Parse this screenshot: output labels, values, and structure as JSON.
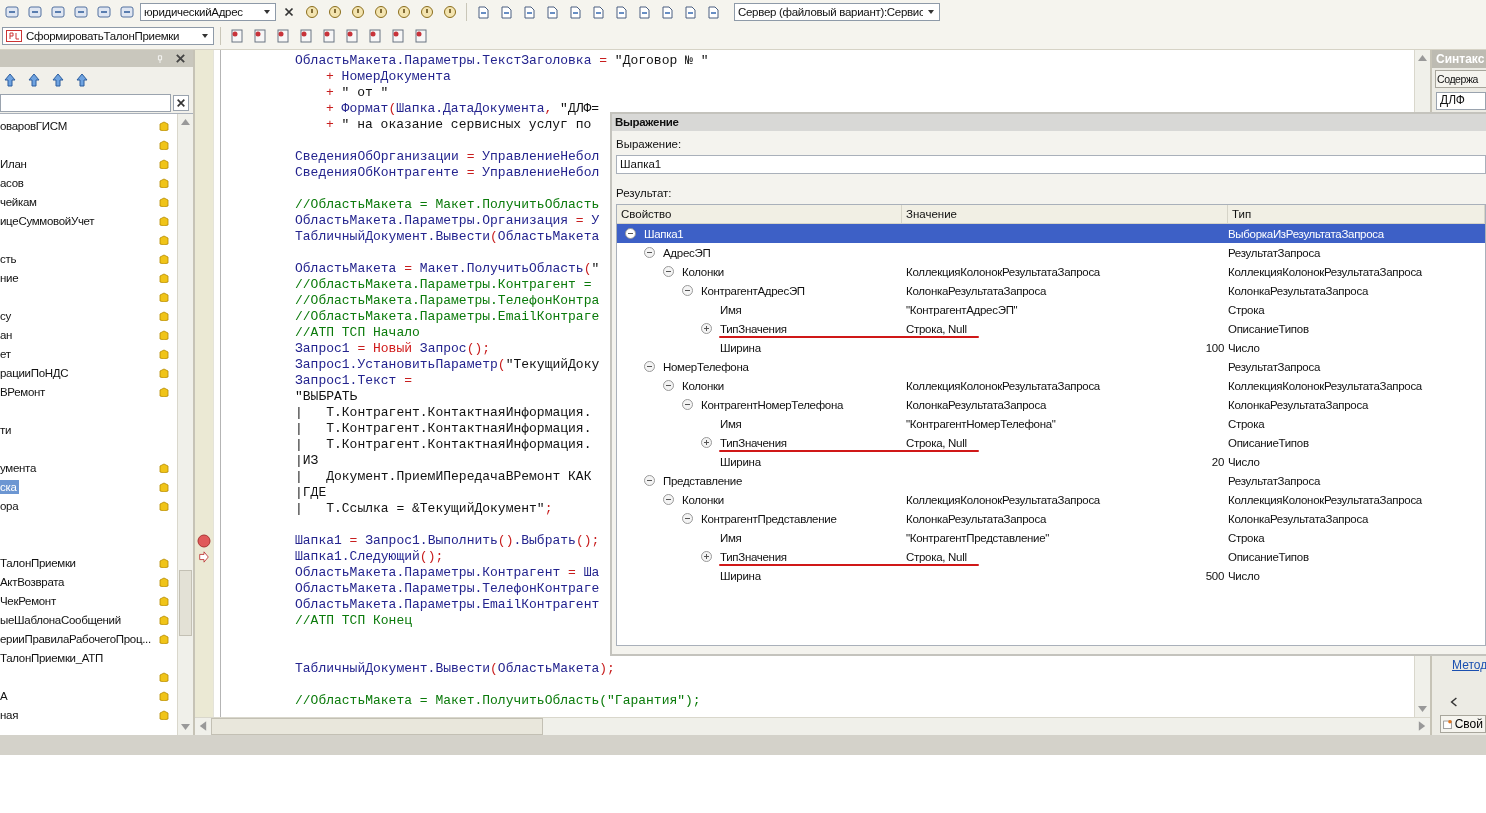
{
  "toolbar": {
    "search": {
      "value": "юридическийАдрес"
    },
    "config": {
      "value": "Сервер (файловый вариант):Сервис"
    },
    "command": {
      "value": "СформироватьТалонПриемки"
    }
  },
  "left_panel": {
    "items": [
      {
        "text": "оваровГИСМ",
        "lock": true,
        "selected": false
      },
      {
        "lock": true,
        "selected": false
      },
      {
        "text": "Илан",
        "lock": true,
        "selected": false
      },
      {
        "text": "асов",
        "lock": true,
        "selected": false
      },
      {
        "text": "чейкам",
        "lock": true,
        "selected": false
      },
      {
        "text": "ицеСуммовойУчет",
        "lock": true,
        "selected": false
      },
      {
        "lock": true,
        "selected": false
      },
      {
        "text": "сть",
        "lock": true,
        "selected": false
      },
      {
        "text": "ние",
        "lock": true,
        "selected": false
      },
      {
        "lock": true,
        "selected": false
      },
      {
        "text": "су",
        "lock": true,
        "selected": false
      },
      {
        "text": "ан",
        "lock": true,
        "selected": false
      },
      {
        "text": "ет",
        "lock": true,
        "selected": false
      },
      {
        "text": "рацииПоНДС",
        "lock": true,
        "selected": false
      },
      {
        "text": "ВРемонт",
        "lock": true,
        "selected": false
      },
      {
        "lock": false,
        "selected": false
      },
      {
        "text": "ти",
        "lock": false,
        "selected": false
      },
      {
        "lock": false,
        "selected": false
      },
      {
        "text": "умента",
        "lock": true,
        "selected": false
      },
      {
        "text": "ска",
        "lock": true,
        "selected": true
      },
      {
        "text": "ора",
        "lock": true,
        "selected": false
      },
      {
        "lock": false,
        "selected": false
      },
      {
        "lock": false,
        "selected": false
      },
      {
        "text": "ТалонПриемки",
        "lock": true,
        "selected": false
      },
      {
        "text": "АктВозврата",
        "lock": true,
        "selected": false
      },
      {
        "text": "ЧекРемонт",
        "lock": true,
        "selected": false
      },
      {
        "text": "ыеШаблонаСообщений",
        "lock": true,
        "selected": false
      },
      {
        "text": "ерииПравилаРабочегоПроц...",
        "lock": true,
        "selected": false
      },
      {
        "text": "ТалонПриемки_АТП",
        "lock": false,
        "selected": false
      },
      {
        "lock": true,
        "selected": false
      },
      {
        "text": "А",
        "lock": true,
        "selected": false
      },
      {
        "text": "ная",
        "lock": true,
        "selected": false
      }
    ]
  },
  "code": {
    "lines": [
      {
        "parts": [
          {
            "text": "ОбластьМакета.Параметры.ТекстЗаголовка",
            "kind": "id"
          },
          {
            "text": " = ",
            "kind": "op"
          },
          {
            "text": "\"Договор № \"",
            "kind": "str"
          }
        ]
      },
      {
        "indent": true,
        "parts": [
          {
            "text": "+ ",
            "kind": "op"
          },
          {
            "text": "НомерДокумента",
            "kind": "id"
          }
        ]
      },
      {
        "indent": true,
        "parts": [
          {
            "text": "+ ",
            "kind": "op"
          },
          {
            "text": "\" от \"",
            "kind": "str"
          }
        ]
      },
      {
        "indent": true,
        "parts": [
          {
            "text": "+ ",
            "kind": "op"
          },
          {
            "text": "Формат",
            "kind": "id"
          },
          {
            "text": "(",
            "kind": "op"
          },
          {
            "text": "Шапка.ДатаДокумента",
            "kind": "id"
          },
          {
            "text": ", ",
            "kind": "op"
          },
          {
            "text": "\"ДЛФ=",
            "kind": "str"
          }
        ]
      },
      {
        "indent": true,
        "parts": [
          {
            "text": "+ ",
            "kind": "op"
          },
          {
            "text": "\" на оказание сервисных услуг по",
            "kind": "str"
          }
        ]
      },
      {
        "gap_before": true,
        "parts": [
          {
            "text": "СведенияОбОрганизации",
            "kind": "id"
          },
          {
            "text": " = ",
            "kind": "op"
          },
          {
            "text": "УправлениеНебол",
            "kind": "id"
          }
        ]
      },
      {
        "parts": [
          {
            "text": "СведенияОбКонтрагенте",
            "kind": "id"
          },
          {
            "text": " = ",
            "kind": "op"
          },
          {
            "text": "УправлениеНебол",
            "kind": "id"
          }
        ]
      },
      {
        "gap_before": true,
        "parts": [
          {
            "text": "//ОбластьМакета = Макет.ПолучитьОбласть",
            "kind": "cmt"
          }
        ]
      },
      {
        "parts": [
          {
            "text": "ОбластьМакета.Параметры.Организация",
            "kind": "id"
          },
          {
            "text": " = ",
            "kind": "op"
          },
          {
            "text": "У",
            "kind": "id"
          }
        ]
      },
      {
        "parts": [
          {
            "text": "ТабличныйДокумент.Вывести",
            "kind": "id"
          },
          {
            "text": "(",
            "kind": "op"
          },
          {
            "text": "ОбластьМакета",
            "kind": "id"
          }
        ]
      },
      {
        "gap_before": true,
        "parts": [
          {
            "text": "ОбластьМакета",
            "kind": "id"
          },
          {
            "text": " = ",
            "kind": "op"
          },
          {
            "text": "Макет.ПолучитьОбласть",
            "kind": "id"
          },
          {
            "text": "(",
            "kind": "op"
          },
          {
            "text": "\"",
            "kind": "str"
          }
        ]
      },
      {
        "parts": [
          {
            "text": "//ОбластьМакета.Параметры.Контрагент =",
            "kind": "cmt"
          }
        ]
      },
      {
        "parts": [
          {
            "text": "//ОбластьМакета.Параметры.ТелефонКонтра",
            "kind": "cmt"
          }
        ]
      },
      {
        "parts": [
          {
            "text": "//ОбластьМакета.Параметры.EmailКонтраге",
            "kind": "cmt"
          }
        ]
      },
      {
        "parts": [
          {
            "text": "//АТП ТСП Начало",
            "kind": "cmt"
          }
        ]
      },
      {
        "parts": [
          {
            "text": "Запрос1",
            "kind": "id"
          },
          {
            "text": " = ",
            "kind": "op"
          },
          {
            "text": "Новый",
            "kind": "kw"
          },
          {
            "text": " Запрос",
            "kind": "id"
          },
          {
            "text": "();",
            "kind": "op"
          }
        ]
      },
      {
        "parts": [
          {
            "text": "Запрос1.УстановитьПараметр",
            "kind": "id"
          },
          {
            "text": "(",
            "kind": "op"
          },
          {
            "text": "\"ТекущийДоку",
            "kind": "str"
          }
        ]
      },
      {
        "parts": [
          {
            "text": "Запрос1.Текст",
            "kind": "id"
          },
          {
            "text": " =",
            "kind": "op"
          }
        ]
      },
      {
        "parts": [
          {
            "text": "\"ВЫБРАТЬ",
            "kind": "str"
          }
        ]
      },
      {
        "parts": [
          {
            "text": "|   Т.Контрагент.КонтактнаяИнформация.",
            "kind": "str"
          }
        ]
      },
      {
        "parts": [
          {
            "text": "|   Т.Контрагент.КонтактнаяИнформация.",
            "kind": "str"
          }
        ]
      },
      {
        "parts": [
          {
            "text": "|   Т.Контрагент.КонтактнаяИнформация.",
            "kind": "str"
          }
        ]
      },
      {
        "parts": [
          {
            "text": "|ИЗ",
            "kind": "str"
          }
        ]
      },
      {
        "parts": [
          {
            "text": "|   Документ.ПриемИПередачаВРемонт КАК",
            "kind": "str"
          }
        ]
      },
      {
        "parts": [
          {
            "text": "|ГДЕ",
            "kind": "str"
          }
        ]
      },
      {
        "parts": [
          {
            "text": "|   Т.Ссылка = &ТекущийДокумент\"",
            "kind": "str"
          },
          {
            "text": ";",
            "kind": "op"
          }
        ]
      },
      {
        "gap_before": true,
        "breakpoint": true,
        "parts": [
          {
            "text": "Шапка1",
            "kind": "id"
          },
          {
            "text": " = ",
            "kind": "op"
          },
          {
            "text": "Запрос1.Выполнить",
            "kind": "id"
          },
          {
            "text": "()",
            "kind": "op"
          },
          {
            "text": ".Выбрать",
            "kind": "id"
          },
          {
            "text": "();",
            "kind": "op"
          }
        ]
      },
      {
        "current": true,
        "parts": [
          {
            "text": "Шапка1.Следующий",
            "kind": "id"
          },
          {
            "text": "();",
            "kind": "op"
          }
        ]
      },
      {
        "parts": [
          {
            "text": "ОбластьМакета.Параметры.Контрагент",
            "kind": "id"
          },
          {
            "text": " = ",
            "kind": "op"
          },
          {
            "text": "Ша",
            "kind": "id"
          }
        ]
      },
      {
        "parts": [
          {
            "text": "ОбластьМакета.Параметры.ТелефонКонтраге",
            "kind": "id"
          }
        ]
      },
      {
        "parts": [
          {
            "text": "ОбластьМакета.Параметры.EmailКонтрагент",
            "kind": "id"
          }
        ]
      },
      {
        "parts": [
          {
            "text": "//АТП ТСП Конец",
            "kind": "cmt"
          }
        ]
      },
      {
        "gap_before": true,
        "double_gap": true,
        "parts": [
          {
            "text": "ТабличныйДокумент.Вывести",
            "kind": "id"
          },
          {
            "text": "(",
            "kind": "op"
          },
          {
            "text": "ОбластьМакета",
            "kind": "id"
          },
          {
            "text": ");",
            "kind": "op"
          }
        ]
      },
      {
        "gap_before": true,
        "parts": [
          {
            "text": "//ОбластьМакета = Макет.ПолучитьОбласть(\"Гарантия\");",
            "kind": "cmt"
          }
        ]
      }
    ]
  },
  "right_panel": {
    "title": "Синтакс",
    "tab": "Содержа",
    "field": "ДЛФ",
    "link": "Метод",
    "button": "Свой"
  },
  "dialog": {
    "title": "Выражение",
    "expression_label": "Выражение:",
    "expression": "Шапка1",
    "result_label": "Результат:",
    "columns": [
      "Свойство",
      "Значение",
      "Тип"
    ],
    "rows": [
      {
        "name": "Шапка1",
        "type": "ВыборкаИзРезультатаЗапроса",
        "expanded": true,
        "selected": true,
        "children": [
          {
            "name": "АдресЭП",
            "type": "РезультатЗапроса",
            "expanded": true,
            "selected": false,
            "children": [
              {
                "name": "Колонки",
                "value": "КоллекцияКолонокРезультатаЗапроса",
                "type": "КоллекцияКолонокРезультатаЗапроса",
                "expanded": true,
                "selected": false,
                "children": [
                  {
                    "name": "КонтрагентАдресЭП",
                    "value": "КолонкаРезультатаЗапроса",
                    "type": "КолонкаРезультатаЗапроса",
                    "expanded": true,
                    "selected": false,
                    "children": [
                      {
                        "name": "Имя",
                        "value": "\"КонтрагентАдресЭП\"",
                        "type": "Строка",
                        "selected": false
                      },
                      {
                        "name": "ТипЗначения",
                        "value": "Строка, Null",
                        "type": "ОписаниеТипов",
                        "expanded": false,
                        "marked": true,
                        "selected": false
                      },
                      {
                        "name": "Ширина",
                        "value": "100",
                        "type": "Число",
                        "kind": "number",
                        "selected": false
                      }
                    ]
                  }
                ]
              }
            ]
          },
          {
            "name": "НомерТелефона",
            "type": "РезультатЗапроса",
            "expanded": true,
            "selected": false,
            "children": [
              {
                "name": "Колонки",
                "value": "КоллекцияКолонокРезультатаЗапроса",
                "type": "КоллекцияКолонокРезультатаЗапроса",
                "expanded": true,
                "selected": false,
                "children": [
                  {
                    "name": "КонтрагентНомерТелефона",
                    "value": "КолонкаРезультатаЗапроса",
                    "type": "КолонкаРезультатаЗапроса",
                    "expanded": true,
                    "selected": false,
                    "children": [
                      {
                        "name": "Имя",
                        "value": "\"КонтрагентНомерТелефона\"",
                        "type": "Строка",
                        "selected": false
                      },
                      {
                        "name": "ТипЗначения",
                        "value": "Строка, Null",
                        "type": "ОписаниеТипов",
                        "expanded": false,
                        "marked": true,
                        "selected": false
                      },
                      {
                        "name": "Ширина",
                        "value": "20",
                        "type": "Число",
                        "kind": "number",
                        "selected": false
                      }
                    ]
                  }
                ]
              }
            ]
          },
          {
            "name": "Представление",
            "type": "РезультатЗапроса",
            "expanded": true,
            "selected": false,
            "children": [
              {
                "name": "Колонки",
                "value": "КоллекцияКолонокРезультатаЗапроса",
                "type": "КоллекцияКолонокРезультатаЗапроса",
                "expanded": true,
                "selected": false,
                "children": [
                  {
                    "name": "КонтрагентПредставление",
                    "value": "КолонкаРезультатаЗапроса",
                    "type": "КолонкаРезультатаЗапроса",
                    "expanded": true,
                    "selected": false,
                    "children": [
                      {
                        "name": "Имя",
                        "value": "\"КонтрагентПредставление\"",
                        "type": "Строка",
                        "selected": false
                      },
                      {
                        "name": "ТипЗначения",
                        "value": "Строка, Null",
                        "type": "ОписаниеТипов",
                        "expanded": false,
                        "marked": true,
                        "selected": false
                      },
                      {
                        "name": "Ширина",
                        "value": "500",
                        "type": "Число",
                        "kind": "number",
                        "selected": false
                      }
                    ]
                  }
                ]
              }
            ]
          }
        ]
      }
    ]
  }
}
